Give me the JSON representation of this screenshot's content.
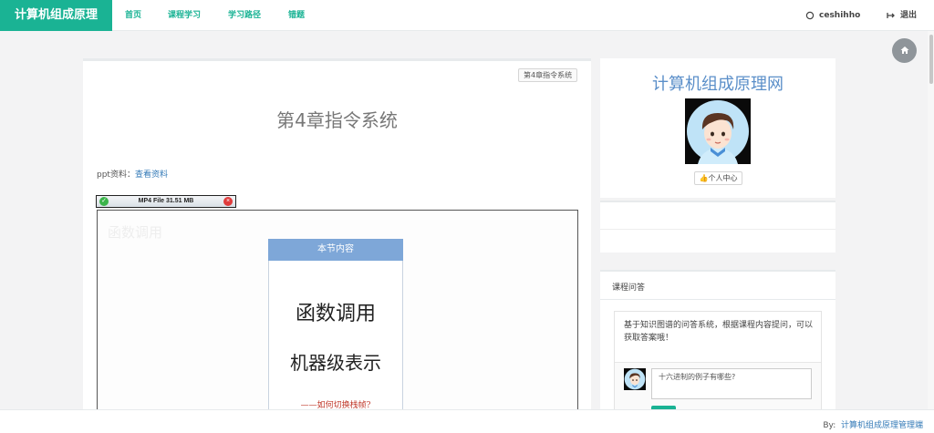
{
  "navbar": {
    "brand": "计算机组成原理",
    "links": [
      "首页",
      "课程学习",
      "学习路径",
      "错题"
    ],
    "username": "ceshihho",
    "logout": "退出"
  },
  "lesson": {
    "chapter_badge": "第4章指令系统",
    "title": "第4章指令系统",
    "ppt_label": "ppt资料：",
    "ppt_link": "查看资料",
    "video_file": "MP4 File 31.51 MB",
    "video_ghost": "函数调用",
    "slide_header": "本节内容",
    "slide_line1": "函数调用",
    "slide_line2": "机器级表示",
    "slide_line3": "——如何切换栈帧?"
  },
  "profile": {
    "site_name": "计算机组成原理网",
    "center_button": "个人中心"
  },
  "qa": {
    "title": "课程问答",
    "intro": "基于知识图谱的问答系统，根据课程内容提问，可以获取答案哦！",
    "input_value": "十六进制的例子有哪些?"
  },
  "footer": {
    "by_label": "By:",
    "link": "计算机组成原理管理端"
  },
  "colors": {
    "brand": "#1ab394",
    "link": "#337ab7",
    "site_name": "#5b8fc9",
    "slide_header": "#7ea7d8"
  }
}
